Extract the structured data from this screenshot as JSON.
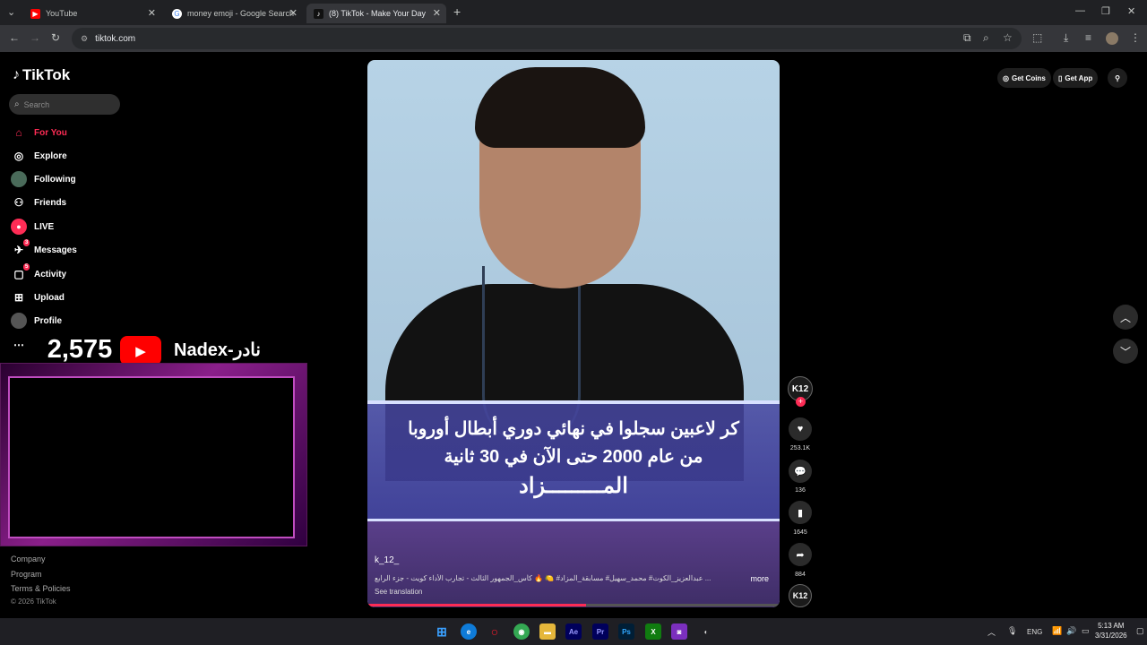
{
  "browser": {
    "tabs": [
      {
        "title": "YouTube",
        "favicon": "youtube-icon",
        "color": "#ff0000"
      },
      {
        "title": "money emoji - Google Search",
        "favicon": "google-icon",
        "color": "#4285f4"
      },
      {
        "title": "(8) TikTok - Make Your Day",
        "favicon": "tiktok-icon",
        "color": "#000000"
      }
    ],
    "url": "tiktok.com"
  },
  "sidebar": {
    "logo": "TikTok",
    "search_placeholder": "Search",
    "items": [
      {
        "label": "For You",
        "icon": "home-icon"
      },
      {
        "label": "Explore",
        "icon": "compass-icon"
      },
      {
        "label": "Following",
        "icon": "following-avatar-icon"
      },
      {
        "label": "Friends",
        "icon": "friends-icon"
      },
      {
        "label": "LIVE",
        "icon": "live-icon"
      },
      {
        "label": "Messages",
        "icon": "messages-icon",
        "badge": "3"
      },
      {
        "label": "Activity",
        "icon": "activity-icon",
        "badge": "5"
      },
      {
        "label": "Upload",
        "icon": "upload-icon"
      },
      {
        "label": "Profile",
        "icon": "profile-icon"
      }
    ],
    "footer": [
      "Company",
      "Program",
      "Terms & Policies",
      "© 2026 TikTok"
    ]
  },
  "stream_overlay": {
    "subscriber_count": "2,575",
    "channel_name": "Nadex-نادر"
  },
  "video": {
    "caption_line1": "كر لاعبين سجلوا في نهائي دوري أبطال أوروبا",
    "caption_line2": "من عام 2000 حتى الآن في 30 ثانية",
    "caption_line3": "المـــــــــزاد",
    "author": "k_12_",
    "description": "عبدالعزيز_الكوت# محمد_سهيل# مسابقة_المزاد# 🍋 🔥 كأس_الجمهور الثالث - تجارب الأداء كويت - جزء الرابع ...",
    "more": "more",
    "see_translation": "See translation",
    "progress": 0.53
  },
  "actions": {
    "avatar_text": "K12",
    "likes": "253.1K",
    "comments": "136",
    "saves": "1645",
    "shares": "884"
  },
  "topright": {
    "get_coins": "Get Coins",
    "get_app": "Get App"
  },
  "taskbar": {
    "time": "5:13 AM",
    "date": "3/31/2026",
    "lang": "ENG"
  }
}
